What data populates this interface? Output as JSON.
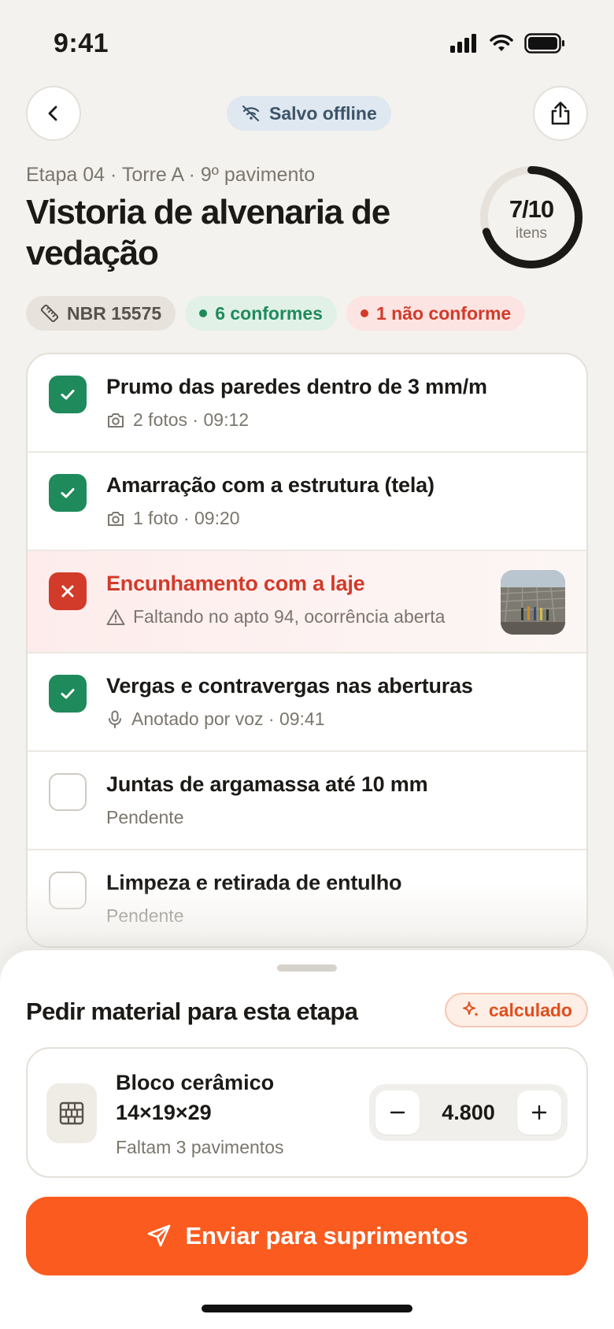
{
  "status_bar": {
    "time": "9:41",
    "icons": [
      "signal-icon",
      "wifi-icon",
      "battery-icon"
    ]
  },
  "nav": {
    "back_icon": "chevron-left-icon",
    "offline_label": "Salvo offline",
    "offline_icon": "wifi-off-icon",
    "share_icon": "share-icon"
  },
  "header": {
    "breadcrumb": "Etapa 04 · Torre A · 9º pavimento",
    "title": "Vistoria de alvenaria de vedação",
    "progress": {
      "count": "7/10",
      "unit": "itens",
      "fraction": 0.7
    }
  },
  "tags": {
    "norm": "NBR 15575",
    "ok": "6 conformes",
    "nok": "1 não conforme"
  },
  "checklist": [
    {
      "status": "ok",
      "title": "Prumo das paredes dentro de 3 mm/m",
      "meta": "2 fotos · 09:12",
      "meta_icon": "camera-icon"
    },
    {
      "status": "ok",
      "title": "Amarração com a estrutura (tela)",
      "meta": "1 foto · 09:20",
      "meta_icon": "camera-icon"
    },
    {
      "status": "fail",
      "title": "Encunhamento com a laje",
      "meta": "Faltando no apto 94, ocorrência aberta",
      "meta_icon": "warning-icon"
    },
    {
      "status": "ok",
      "title": "Vergas e contravergas nas aberturas",
      "meta": "Anotado por voz · 09:41",
      "meta_icon": "mic-icon"
    },
    {
      "status": "pending",
      "title": "Juntas de argamassa até 10 mm",
      "meta": "Pendente"
    },
    {
      "status": "pending",
      "title": "Limpeza e retirada de entulho",
      "meta": "Pendente"
    }
  ],
  "sheet": {
    "title": "Pedir material para esta etapa",
    "calc_label": "calculado",
    "calc_icon": "sparkle-icon",
    "material": {
      "icon": "brick-icon",
      "name": "Bloco cerâmico 14×19×29",
      "note": "Faltam 3 pavimentos",
      "quantity": "4.800"
    },
    "send_label": "Enviar para suprimentos",
    "send_icon": "send-icon"
  },
  "colors": {
    "accent": "#fb5b1e",
    "success": "#1f8a5b",
    "danger": "#d23a2a",
    "offline_bg": "#dfe8f0"
  }
}
